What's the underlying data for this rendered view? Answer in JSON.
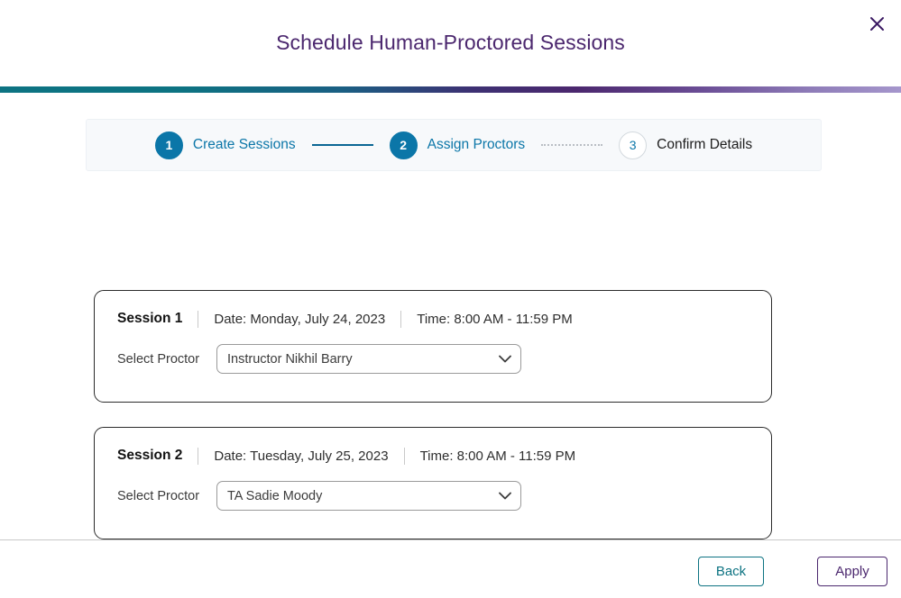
{
  "modal": {
    "title": "Schedule Human-Proctored Sessions",
    "close_icon": "close-icon",
    "accent_teal": "#0d7382",
    "accent_purple": "#4b276e",
    "accent_blue": "#0b76a8"
  },
  "stepper": {
    "steps": [
      {
        "number": "1",
        "label": "Create Sessions",
        "state": "done"
      },
      {
        "number": "2",
        "label": "Assign Proctors",
        "state": "done"
      },
      {
        "number": "3",
        "label": "Confirm Details",
        "state": "todo"
      }
    ],
    "connectors": [
      {
        "style": "solid"
      },
      {
        "style": "dotted"
      }
    ]
  },
  "sessions": [
    {
      "name": "Session 1",
      "date": "Date: Monday, July 24, 2023",
      "time": "Time: 8:00 AM - 11:59 PM",
      "proctor_label": "Select Proctor",
      "proctor_value": "Instructor Nikhil Barry",
      "proctor_placeholder": "Select Proctor"
    },
    {
      "name": "Session 2",
      "date": "Date: Tuesday, July 25, 2023",
      "time": "Time: 8:00 AM - 11:59 PM",
      "proctor_label": "Select Proctor",
      "proctor_value": "TA Sadie Moody",
      "proctor_placeholder": "Select Proctor"
    }
  ],
  "footer": {
    "back_label": "Back",
    "apply_label": "Apply"
  }
}
